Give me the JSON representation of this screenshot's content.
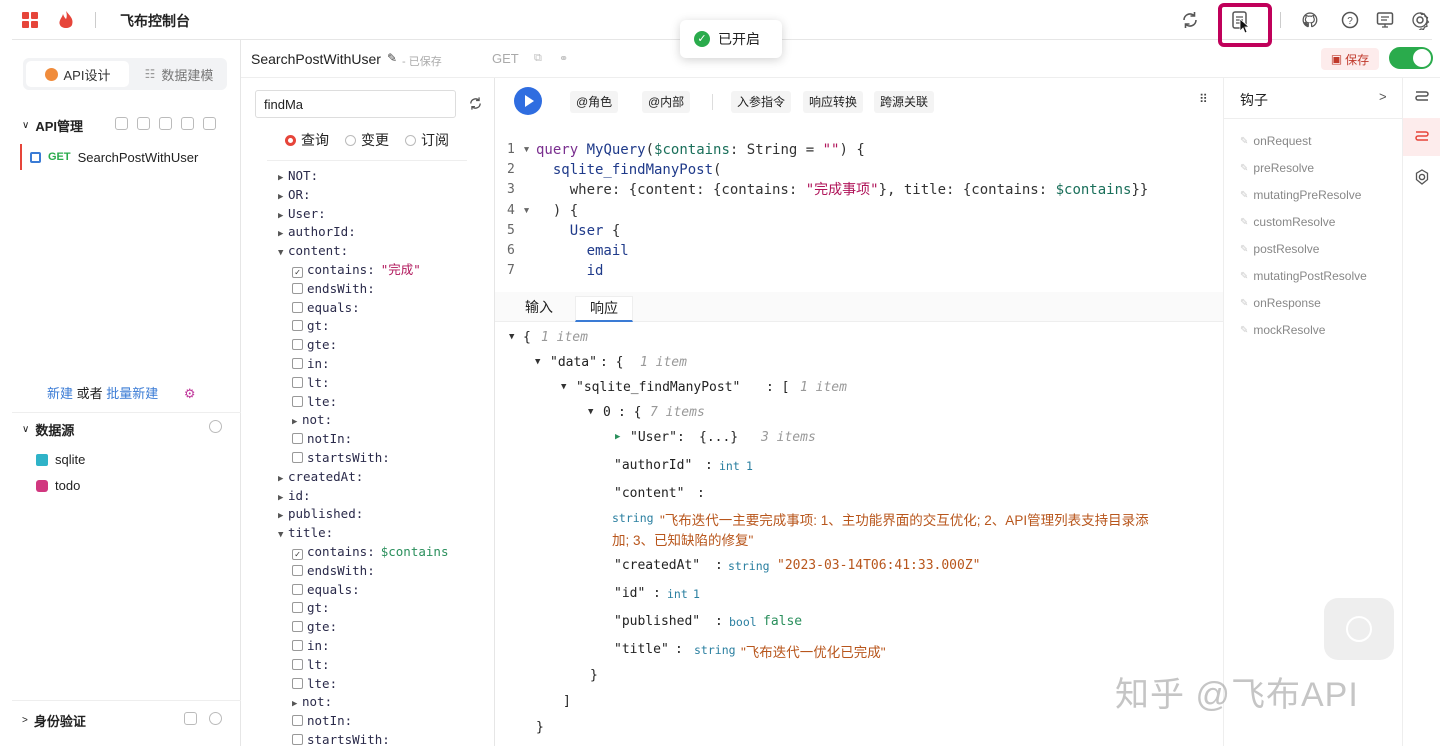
{
  "app": {
    "title": "飞布控制台"
  },
  "toast": {
    "text": "已开启"
  },
  "left_tabs": {
    "api_design": "API设计",
    "data_modeling": "数据建模"
  },
  "api_section": {
    "title": "API管理",
    "item_method": "GET",
    "item_name": "SearchPostWithUser"
  },
  "new_links": {
    "new": "新建",
    "or": "或者",
    "batch_new": "批量新建"
  },
  "datasource": {
    "title": "数据源",
    "items": [
      "sqlite",
      "todo"
    ]
  },
  "auth": {
    "title": "身份验证"
  },
  "pathbar": {
    "name": "SearchPostWithUser",
    "saved_status": "- 已保存",
    "method": "GET",
    "save_label": "保存",
    "toggle_on": true
  },
  "fields": {
    "search_value": "findMa",
    "radios": [
      "查询",
      "变更",
      "订阅"
    ],
    "tree": [
      {
        "text": "NOT:",
        "kind": "arrow",
        "indent": 0
      },
      {
        "text": "OR:",
        "kind": "arrow",
        "indent": 0
      },
      {
        "text": "User:",
        "kind": "arrow",
        "indent": 0
      },
      {
        "text": "authorId:",
        "kind": "arrow",
        "indent": 0
      },
      {
        "text": "content:",
        "kind": "open",
        "indent": 0
      },
      {
        "text": "contains:",
        "kind": "checked",
        "indent": 1,
        "value": "\"完成\"",
        "vclass": "sv"
      },
      {
        "text": "endsWith:",
        "kind": "box",
        "indent": 1
      },
      {
        "text": "equals:",
        "kind": "box",
        "indent": 1
      },
      {
        "text": "gt:",
        "kind": "box",
        "indent": 1
      },
      {
        "text": "gte:",
        "kind": "box",
        "indent": 1
      },
      {
        "text": "in:",
        "kind": "box",
        "indent": 1
      },
      {
        "text": "lt:",
        "kind": "box",
        "indent": 1
      },
      {
        "text": "lte:",
        "kind": "box",
        "indent": 1
      },
      {
        "text": "not:",
        "kind": "arrow",
        "indent": 1
      },
      {
        "text": "notIn:",
        "kind": "box",
        "indent": 1
      },
      {
        "text": "startsWith:",
        "kind": "box",
        "indent": 1
      },
      {
        "text": "createdAt:",
        "kind": "arrow",
        "indent": 0
      },
      {
        "text": "id:",
        "kind": "arrow",
        "indent": 0
      },
      {
        "text": "published:",
        "kind": "arrow",
        "indent": 0
      },
      {
        "text": "title:",
        "kind": "open",
        "indent": 0
      },
      {
        "text": "contains:",
        "kind": "checked",
        "indent": 1,
        "value": "$contains",
        "vclass": "vv"
      },
      {
        "text": "endsWith:",
        "kind": "box",
        "indent": 1
      },
      {
        "text": "equals:",
        "kind": "box",
        "indent": 1
      },
      {
        "text": "gt:",
        "kind": "box",
        "indent": 1
      },
      {
        "text": "gte:",
        "kind": "box",
        "indent": 1
      },
      {
        "text": "in:",
        "kind": "box",
        "indent": 1
      },
      {
        "text": "lt:",
        "kind": "box",
        "indent": 1
      },
      {
        "text": "lte:",
        "kind": "box",
        "indent": 1
      },
      {
        "text": "not:",
        "kind": "arrow",
        "indent": 1
      },
      {
        "text": "notIn:",
        "kind": "box",
        "indent": 1
      },
      {
        "text": "startsWith:",
        "kind": "box",
        "indent": 1
      }
    ]
  },
  "toolbar": {
    "role": "@角色",
    "internal": "@内部",
    "param_directive": "入参指令",
    "response_transform": "响应转换",
    "cross_source": "跨源关联"
  },
  "code_lines": [
    "query MyQuery($contains: String = \"\") {",
    "  sqlite_findManyPost(",
    "    where: {content: {contains: \"完成事项\"}, title: {contains: $contains}}",
    "  ) {",
    "    User {",
    "      email",
    "      id"
  ],
  "line_markers": [
    "1",
    "2",
    "3",
    "4",
    "5",
    "6",
    "7"
  ],
  "editor_tabs": {
    "input": "输入",
    "response": "响应"
  },
  "json_view": {
    "one_item": "1 item",
    "data_key": "\"data\"",
    "find_key": "\"sqlite_findManyPost\"",
    "index": "0",
    "seven_items": "7 items",
    "user_key": "\"User\"",
    "user_collapsed": "{...}",
    "three_items": "3 items",
    "author_key": "\"authorId\"",
    "author_type": "int",
    "author_val": "1",
    "content_key": "\"content\"",
    "content_type": "string",
    "content_val_1": "\"飞布迭代一主要完成事项: 1、主功能界面的交互优化; 2、API管理列表支持目录添",
    "content_val_2": "加; 3、已知缺陷的修复\"",
    "created_key": "\"createdAt\"",
    "created_type": "string",
    "created_val": "\"2023-03-14T06:41:33.000Z\"",
    "id_key": "\"id\"",
    "id_type": "int",
    "id_val": "1",
    "published_key": "\"published\"",
    "published_type": "bool",
    "published_val": "false",
    "title_key": "\"title\"",
    "title_type": "string",
    "title_val": "\"飞布迭代一优化已完成\""
  },
  "hooks": {
    "title": "钩子",
    "items": [
      "onRequest",
      "preResolve",
      "mutatingPreResolve",
      "customResolve",
      "postResolve",
      "mutatingPostResolve",
      "onResponse",
      "mockResolve"
    ]
  },
  "watermark": "知乎 @飞布API",
  "colors": {
    "accent": "#e6453a",
    "primary_blue": "#2f6de0",
    "success": "#2aab4c",
    "highlight": "#c0005a"
  }
}
